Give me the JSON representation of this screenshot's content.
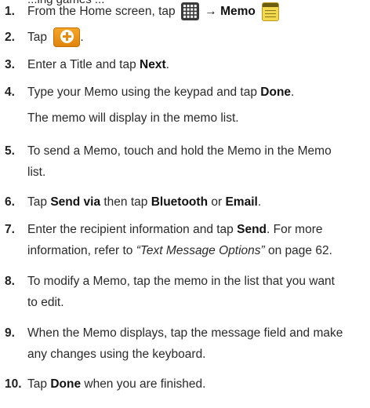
{
  "clipped_top_text": "...ing games ...",
  "steps": [
    {
      "number": "1.",
      "text_before": "From the Home screen, tap",
      "arrow": "→",
      "bold": "Memo",
      "grid_icon": "apps-grid-icon",
      "memo_icon": "memo-notepad-icon"
    },
    {
      "number": "2.",
      "text_before": "Tap",
      "after": ".",
      "add_icon": "add-plus-icon",
      "colors": {
        "add_button": "#f29a1c"
      }
    },
    {
      "number": "3.",
      "text_before": "Enter a Title and tap",
      "bold": "Next",
      "after": "."
    },
    {
      "number": "4.",
      "text_before": "Type your Memo using the keypad and tap",
      "bold": "Done",
      "after": ".",
      "note": "The memo will display in the memo list."
    },
    {
      "number": "5.",
      "line1": "To send a Memo, touch and hold the Memo in the Memo",
      "line2": "list."
    },
    {
      "number": "6.",
      "text_before": "Tap",
      "bold1": "Send via",
      "middle": "then tap",
      "bold2": "Bluetooth",
      "or": "or",
      "bold3": "Email",
      "after": "."
    },
    {
      "number": "7.",
      "text_before": "Enter the recipient information and tap",
      "bold": "Send",
      "after": ". For more",
      "line2_before": "information, refer to",
      "italic": "“Text Message Options”",
      "line2_after": "on page 62."
    },
    {
      "number": "8.",
      "line1": "To modify a Memo, tap the memo in the list that you want",
      "line2": "to edit."
    },
    {
      "number": "9.",
      "line1": "When the Memo displays, tap the message field and make",
      "line2": "any changes using the keyboard."
    },
    {
      "number": "10.",
      "text_before": "Tap",
      "bold": "Done",
      "after": "when you are finished."
    }
  ]
}
